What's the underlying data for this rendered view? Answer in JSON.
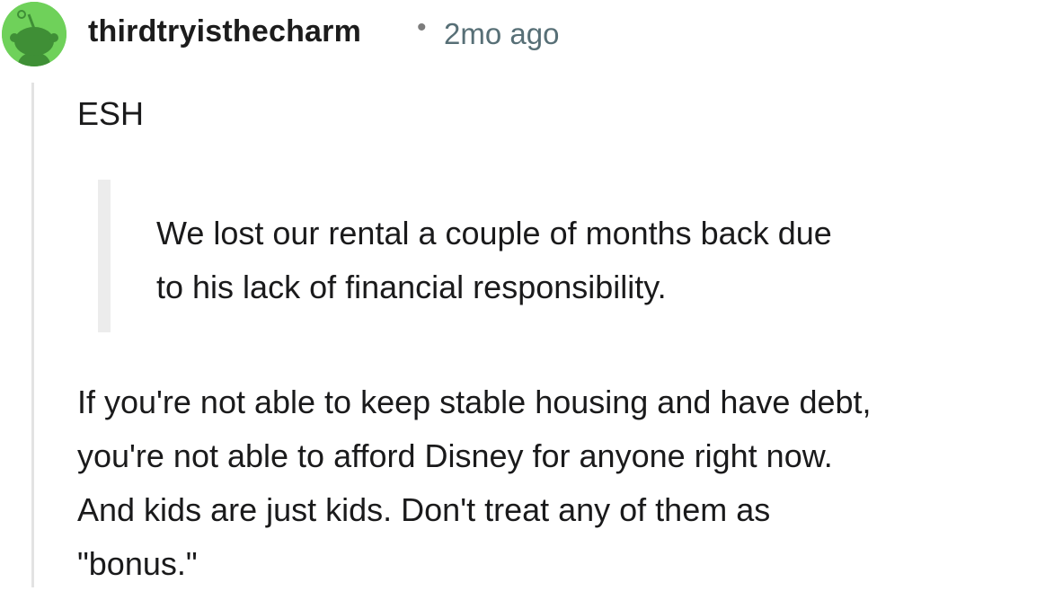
{
  "comment": {
    "avatar_icon": "reddit-snoo-avatar-icon",
    "avatar_color": "#6fd15a",
    "username": "thirdtryisthecharm",
    "separator": "•",
    "timestamp": "2mo ago",
    "verdict": "ESH",
    "quote_lines": [
      "We lost our rental a couple of months back due",
      "to his lack of financial responsibility."
    ],
    "body_lines": [
      "If you're not able to keep stable housing and have debt,",
      "you're not able to afford Disney for anyone right now.",
      "And kids are just kids. Don't treat any of them as",
      "\"bonus.\""
    ]
  }
}
